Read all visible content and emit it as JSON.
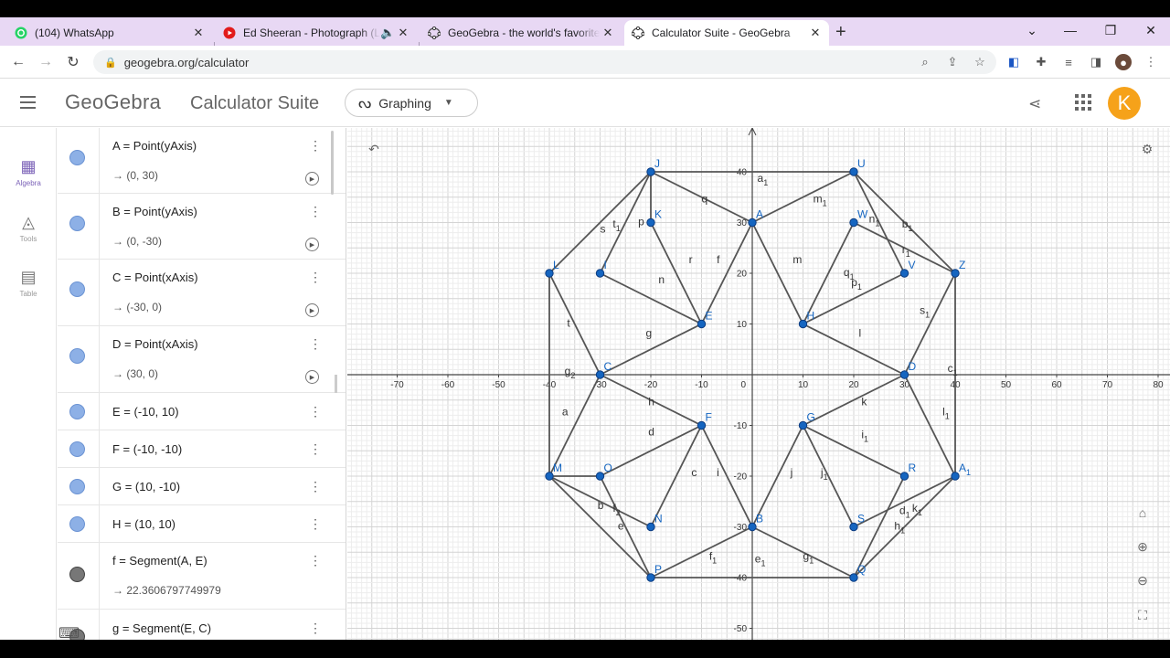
{
  "browser": {
    "tabs": [
      {
        "title": "(104) WhatsApp",
        "favicon": "whatsapp-icon",
        "color": "#25d366"
      },
      {
        "title": "Ed Sheeran - Photograph (Lyrics)",
        "favicon": "youtube-icon",
        "color": "#ff0000",
        "audio": "🔈"
      },
      {
        "title": "GeoGebra - the world's favorite, free",
        "favicon": "geogebra-icon",
        "color": "#555555"
      },
      {
        "title": "Calculator Suite - GeoGebra",
        "favicon": "geogebra-icon",
        "color": "#555555",
        "active": true
      }
    ],
    "new_tab": "+",
    "tab_close": "✕",
    "url": "geogebra.org/calculator",
    "win": {
      "list": "⌄",
      "min": "—",
      "max": "❐",
      "close": "✕"
    }
  },
  "header": {
    "logo": "GeoGebra",
    "suite_title": "Calculator Suite",
    "app_selector": "Graphing",
    "avatar_letter": "K",
    "avatar_color": "#f6a21a"
  },
  "rail": [
    {
      "label": "Algebra",
      "icon": "▦",
      "selected": true
    },
    {
      "label": "Tools",
      "icon": "◬"
    },
    {
      "label": "Table",
      "icon": "▤"
    }
  ],
  "algebra": [
    {
      "def": "A  =  Point(yAxis)",
      "val": "→  (0, 30)",
      "play": true
    },
    {
      "def": "B  =  Point(yAxis)",
      "val": "→  (0, -30)",
      "play": true
    },
    {
      "def": "C  =  Point(xAxis)",
      "val": "→  (-30, 0)",
      "play": true
    },
    {
      "def": "D  =  Point(xAxis)",
      "val": "→  (30, 0)",
      "play": true
    },
    {
      "def": "E  =  (-10, 10)"
    },
    {
      "def": "F  =  (-10, -10)"
    },
    {
      "def": "G  =  (10, -10)"
    },
    {
      "def": "H  =  (10, 10)"
    },
    {
      "def": "f  =  Segment(A, E)",
      "val": "→  22.3606797749979",
      "dark": true
    },
    {
      "def": "g  =  Segment(E, C)",
      "dark": true
    }
  ],
  "more_glyph": "⋮",
  "play_glyph": "▶",
  "graph": {
    "x_ticks": [
      -70,
      -60,
      -50,
      -40,
      -30,
      -20,
      -10,
      10,
      20,
      30,
      40,
      50,
      60,
      70,
      80
    ],
    "y_ticks": [
      40,
      30,
      20,
      10,
      -10,
      -20,
      -30,
      -40,
      -50
    ],
    "origin_label": "0",
    "point_color": "#1565c0",
    "segment_color": "#555555",
    "label_color": "#1565c0",
    "points": [
      {
        "name": "J",
        "x": -20,
        "y": 40
      },
      {
        "name": "U",
        "x": 20,
        "y": 40
      },
      {
        "name": "A",
        "x": 0,
        "y": 30
      },
      {
        "name": "K",
        "x": -20,
        "y": 30
      },
      {
        "name": "W",
        "x": 20,
        "y": 30
      },
      {
        "name": "L",
        "x": -40,
        "y": 20
      },
      {
        "name": "I",
        "x": -30,
        "y": 20
      },
      {
        "name": "V",
        "x": 30,
        "y": 20
      },
      {
        "name": "Z",
        "x": 40,
        "y": 20
      },
      {
        "name": "E",
        "x": -10,
        "y": 10
      },
      {
        "name": "H",
        "x": 10,
        "y": 10
      },
      {
        "name": "C",
        "x": -30,
        "y": 0
      },
      {
        "name": "D",
        "x": 30,
        "y": 0
      },
      {
        "name": "F",
        "x": -10,
        "y": -10
      },
      {
        "name": "G",
        "x": 10,
        "y": -10
      },
      {
        "name": "M",
        "x": -40,
        "y": -20
      },
      {
        "name": "O",
        "x": -30,
        "y": -20
      },
      {
        "name": "R",
        "x": 30,
        "y": -20
      },
      {
        "name": "A1",
        "x": 40,
        "y": -20
      },
      {
        "name": "N",
        "x": -20,
        "y": -30
      },
      {
        "name": "B",
        "x": 0,
        "y": -30
      },
      {
        "name": "S",
        "x": 20,
        "y": -30
      },
      {
        "name": "P",
        "x": -20,
        "y": -40
      },
      {
        "name": "Q",
        "x": 20,
        "y": -40
      }
    ],
    "segments": [
      [
        "J",
        "U"
      ],
      [
        "U",
        "Z"
      ],
      [
        "Z",
        "A1"
      ],
      [
        "A1",
        "Q"
      ],
      [
        "Q",
        "P"
      ],
      [
        "P",
        "M"
      ],
      [
        "M",
        "L"
      ],
      [
        "L",
        "J"
      ],
      [
        "A",
        "E"
      ],
      [
        "E",
        "C"
      ],
      [
        "C",
        "F"
      ],
      [
        "F",
        "B"
      ],
      [
        "B",
        "G"
      ],
      [
        "G",
        "D"
      ],
      [
        "D",
        "H"
      ],
      [
        "H",
        "A"
      ],
      [
        "J",
        "A"
      ],
      [
        "A",
        "U"
      ],
      [
        "J",
        "I"
      ],
      [
        "J",
        "K"
      ],
      [
        "K",
        "E"
      ],
      [
        "I",
        "E"
      ],
      [
        "L",
        "C"
      ],
      [
        "C",
        "M"
      ],
      [
        "M",
        "O"
      ],
      [
        "O",
        "F"
      ],
      [
        "O",
        "P"
      ],
      [
        "M",
        "N"
      ],
      [
        "N",
        "F"
      ],
      [
        "P",
        "B"
      ],
      [
        "B",
        "Q"
      ],
      [
        "Q",
        "R"
      ],
      [
        "S",
        "G"
      ],
      [
        "G",
        "R"
      ],
      [
        "A1",
        "S"
      ],
      [
        "A1",
        "D"
      ],
      [
        "D",
        "Z"
      ],
      [
        "Z",
        "W"
      ],
      [
        "U",
        "V"
      ],
      [
        "W",
        "H"
      ],
      [
        "V",
        "H"
      ]
    ],
    "segment_labels": [
      {
        "t": "a1",
        "x": 1,
        "y": 38
      },
      {
        "t": "q",
        "x": -10,
        "y": 34
      },
      {
        "t": "m1",
        "x": 12,
        "y": 34
      },
      {
        "t": "s",
        "x": -30,
        "y": 28
      },
      {
        "t": "t1",
        "x": -27.5,
        "y": 29
      },
      {
        "t": "p",
        "x": -22.5,
        "y": 29.5
      },
      {
        "t": "n1",
        "x": 23,
        "y": 30
      },
      {
        "t": "b1",
        "x": 29.5,
        "y": 29
      },
      {
        "t": "r1",
        "x": 29.5,
        "y": 24
      },
      {
        "t": "r",
        "x": -12.5,
        "y": 22
      },
      {
        "t": "f",
        "x": -7,
        "y": 22
      },
      {
        "t": "m",
        "x": 8,
        "y": 22
      },
      {
        "t": "q1",
        "x": 18,
        "y": 19.5
      },
      {
        "t": "p1",
        "x": 19.5,
        "y": 17.5
      },
      {
        "t": "n",
        "x": -18.5,
        "y": 18
      },
      {
        "t": "s1",
        "x": 33,
        "y": 12
      },
      {
        "t": "t",
        "x": -36.5,
        "y": 9.5
      },
      {
        "t": "g",
        "x": -21,
        "y": 7.5
      },
      {
        "t": "l",
        "x": 21,
        "y": 7.5
      },
      {
        "t": "g2",
        "x": -37,
        "y": 0
      },
      {
        "t": "c1",
        "x": 38.5,
        "y": 0.5
      },
      {
        "t": "h",
        "x": -20.5,
        "y": -6
      },
      {
        "t": "k",
        "x": 21.5,
        "y": -6
      },
      {
        "t": "a",
        "x": -37.5,
        "y": -8
      },
      {
        "t": "l1",
        "x": 37.5,
        "y": -8
      },
      {
        "t": "d",
        "x": -20.5,
        "y": -12
      },
      {
        "t": "i1",
        "x": 21.5,
        "y": -12.5
      },
      {
        "t": "c",
        "x": -12,
        "y": -20
      },
      {
        "t": "i",
        "x": -7,
        "y": -20
      },
      {
        "t": "j",
        "x": 7.5,
        "y": -20
      },
      {
        "t": "j1",
        "x": 13.5,
        "y": -20
      },
      {
        "t": "b",
        "x": -30.5,
        "y": -26.5
      },
      {
        "t": "f2",
        "x": -27.5,
        "y": -27
      },
      {
        "t": "e",
        "x": -26.5,
        "y": -30.5
      },
      {
        "t": "d1",
        "x": 29,
        "y": -27.5
      },
      {
        "t": "k1",
        "x": 31.5,
        "y": -27
      },
      {
        "t": "h1",
        "x": 28,
        "y": -30.5
      },
      {
        "t": "f1",
        "x": -8.5,
        "y": -36.5
      },
      {
        "t": "e1",
        "x": 0.5,
        "y": -37
      },
      {
        "t": "g1",
        "x": 10,
        "y": -36.5
      }
    ]
  }
}
